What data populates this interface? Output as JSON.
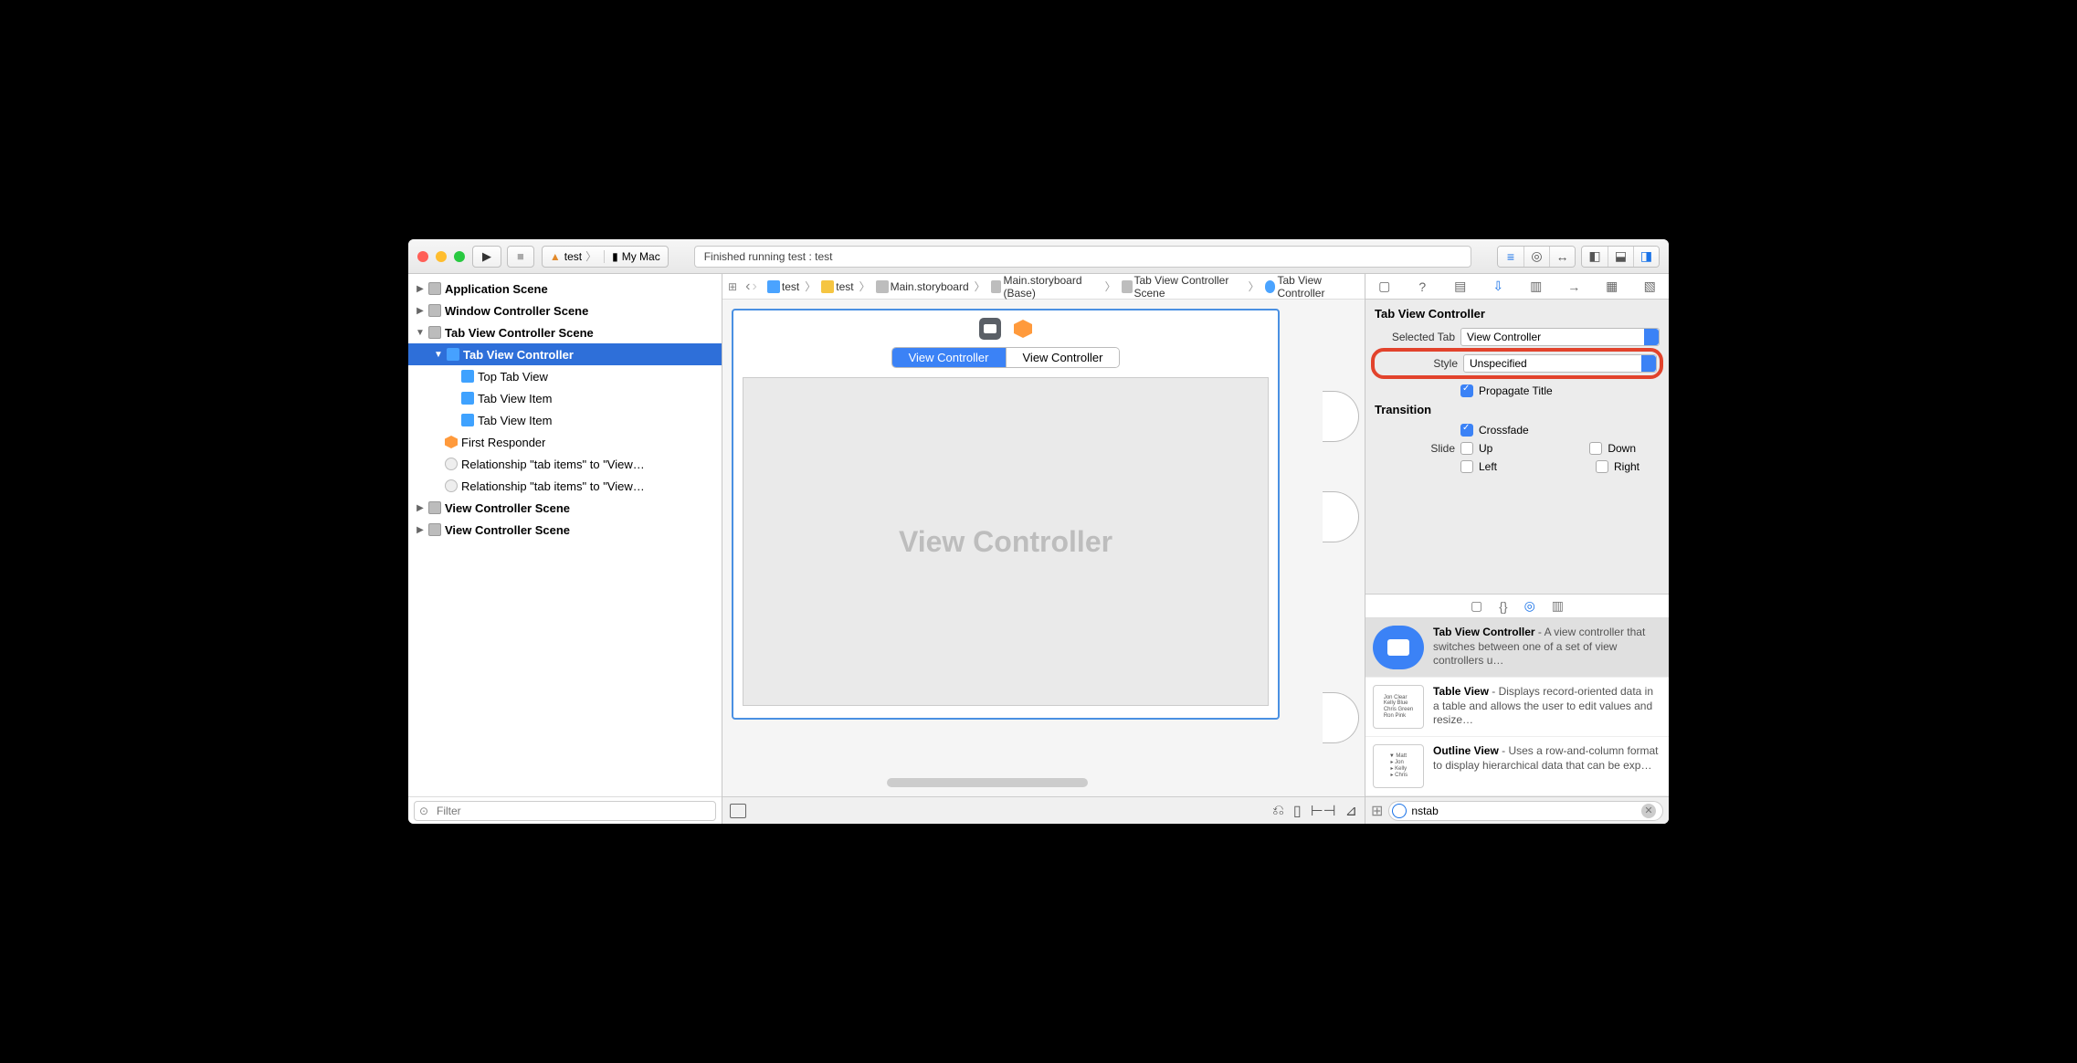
{
  "toolbar": {
    "scheme_app": "test",
    "scheme_dest": "My Mac",
    "status": "Finished running test : test"
  },
  "breadcrumb": {
    "items": [
      "test",
      "test",
      "Main.storyboard",
      "Main.storyboard (Base)",
      "Tab View Controller Scene",
      "Tab View Controller"
    ]
  },
  "outline": {
    "app_scene": "Application Scene",
    "win_scene": "Window Controller Scene",
    "tvc_scene": "Tab View Controller Scene",
    "tvc": "Tab View Controller",
    "top_tab": "Top Tab View",
    "tvi1": "Tab View Item",
    "tvi2": "Tab View Item",
    "fr": "First Responder",
    "rel1": "Relationship \"tab items\" to \"View…",
    "rel2": "Relationship \"tab items\" to \"View…",
    "vc1": "View Controller Scene",
    "vc2": "View Controller Scene",
    "filter_placeholder": "Filter"
  },
  "canvas": {
    "tab1": "View Controller",
    "tab2": "View Controller",
    "placeholder": "View Controller"
  },
  "inspector": {
    "title": "Tab View Controller",
    "selected_tab_label": "Selected Tab",
    "selected_tab_value": "View Controller",
    "style_label": "Style",
    "style_value": "Unspecified",
    "propagate": "Propagate Title",
    "transition_title": "Transition",
    "crossfade": "Crossfade",
    "slide_label": "Slide",
    "up": "Up",
    "down": "Down",
    "left": "Left",
    "right": "Right"
  },
  "library": {
    "items": [
      {
        "title": "Tab View Controller",
        "desc": " - A view controller that switches between one of a set of view controllers u…"
      },
      {
        "title": "Table View",
        "desc": " - Displays record-oriented data in a table and allows the user to edit values and resize…"
      },
      {
        "title": "Outline View",
        "desc": " - Uses a row-and-column format to display hierarchical data that can be exp…"
      }
    ],
    "filter_value": "nstab"
  }
}
